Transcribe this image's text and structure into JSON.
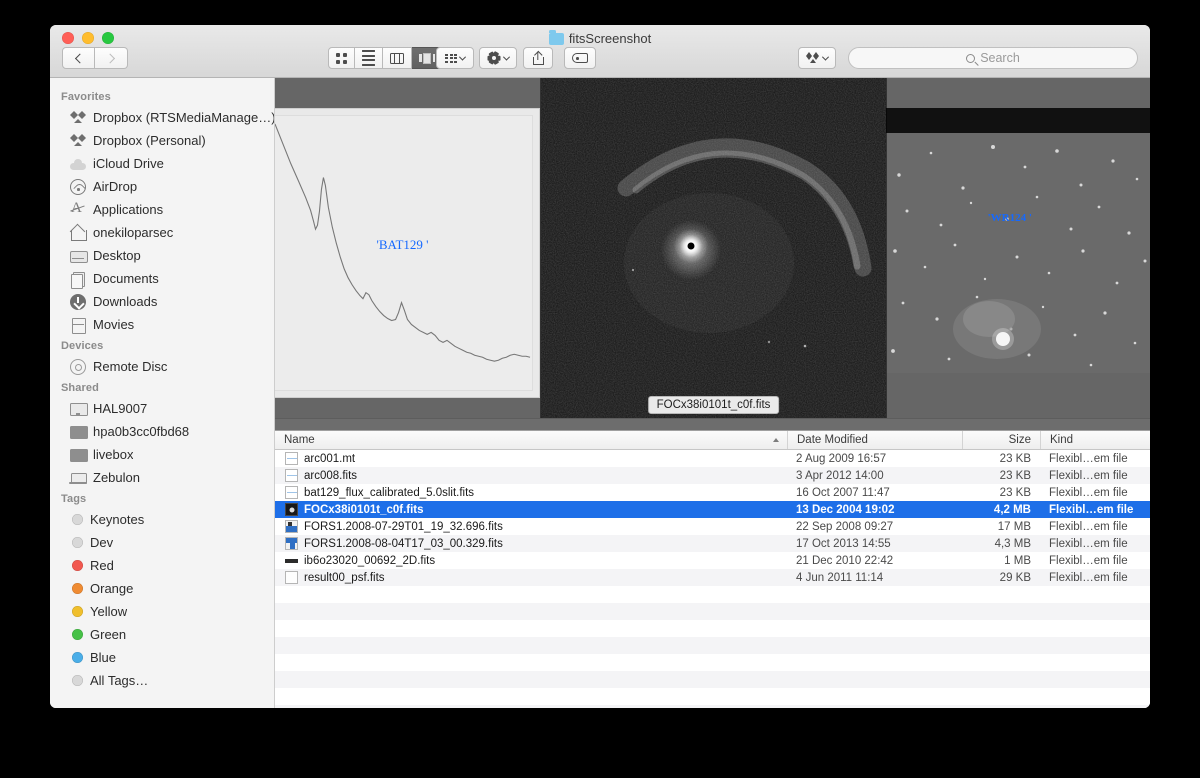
{
  "window": {
    "title": "fitsScreenshot",
    "title_icon": "blue-folder-icon",
    "traffic_lights": [
      "close",
      "minimize",
      "zoom"
    ]
  },
  "toolbar": {
    "back_label": "‹",
    "forward_label": "›",
    "view_modes": [
      {
        "name": "icon-view",
        "active": false
      },
      {
        "name": "list-view",
        "active": false
      },
      {
        "name": "column-view",
        "active": false
      },
      {
        "name": "coverflow-view",
        "active": true
      }
    ],
    "arrange_label": "arrange-icon",
    "action_label": "gear-icon",
    "share_label": "share-icon",
    "tag_label": "tag-icon",
    "dropbox_label": "dropbox-icon"
  },
  "search": {
    "placeholder": "Search",
    "value": ""
  },
  "sidebar": {
    "sections": [
      {
        "header": "Favorites",
        "items": [
          {
            "label": "Dropbox (RTSMediaManage…)",
            "icon": "dropbox-icon"
          },
          {
            "label": "Dropbox (Personal)",
            "icon": "dropbox-icon"
          },
          {
            "label": "iCloud Drive",
            "icon": "cloud-icon"
          },
          {
            "label": "AirDrop",
            "icon": "airdrop-icon"
          },
          {
            "label": "Applications",
            "icon": "applications-icon"
          },
          {
            "label": "onekiloparsec",
            "icon": "home-icon"
          },
          {
            "label": "Desktop",
            "icon": "desktop-icon"
          },
          {
            "label": "Documents",
            "icon": "documents-icon"
          },
          {
            "label": "Downloads",
            "icon": "downloads-icon"
          },
          {
            "label": "Movies",
            "icon": "movies-icon"
          }
        ]
      },
      {
        "header": "Devices",
        "items": [
          {
            "label": "Remote Disc",
            "icon": "disc-icon"
          }
        ]
      },
      {
        "header": "Shared",
        "items": [
          {
            "label": "HAL9007",
            "icon": "display-icon"
          },
          {
            "label": "hpa0b3cc0fbd68",
            "icon": "computer-icon"
          },
          {
            "label": "livebox",
            "icon": "computer-icon"
          },
          {
            "label": "Zebulon",
            "icon": "laptop-icon"
          }
        ]
      },
      {
        "header": "Tags",
        "items": [
          {
            "label": "Keynotes",
            "icon": "tag-dot",
            "color": "#d8d8d8"
          },
          {
            "label": "Dev",
            "icon": "tag-dot",
            "color": "#d8d8d8"
          },
          {
            "label": "Red",
            "icon": "tag-dot",
            "color": "#f1584f"
          },
          {
            "label": "Orange",
            "icon": "tag-dot",
            "color": "#ef8b32"
          },
          {
            "label": "Yellow",
            "icon": "tag-dot",
            "color": "#f0bf2c"
          },
          {
            "label": "Green",
            "icon": "tag-dot",
            "color": "#46c147"
          },
          {
            "label": "Blue",
            "icon": "tag-dot",
            "color": "#4aaee8"
          },
          {
            "label": "All Tags…",
            "icon": "tag-dot",
            "color": "#d8d8d8"
          }
        ]
      }
    ]
  },
  "coverflow": {
    "left_preview": {
      "label": "'BAT129  '",
      "type": "spectrum-plot"
    },
    "center_preview": {
      "caption": "FOCx38i0101t_c0f.fits",
      "type": "astronomical-image"
    },
    "right_preview": {
      "label": "'WR124  '",
      "type": "starfield-image"
    }
  },
  "file_list": {
    "columns": {
      "name": "Name",
      "date_modified": "Date Modified",
      "size": "Size",
      "kind": "Kind",
      "sort_column": "Name",
      "sort_direction": "ascending"
    },
    "rows": [
      {
        "name": "arc001.mt",
        "date": "2 Aug 2009 16:57",
        "size": "23 KB",
        "kind": "Flexibl…em file",
        "icon": "spectrum-thumb",
        "selected": false
      },
      {
        "name": "arc008.fits",
        "date": "3 Apr 2012 14:00",
        "size": "23 KB",
        "kind": "Flexibl…em file",
        "icon": "spectrum-thumb",
        "selected": false
      },
      {
        "name": "bat129_flux_calibrated_5.0slit.fits",
        "date": "16 Oct 2007 11:47",
        "size": "23 KB",
        "kind": "Flexibl…em file",
        "icon": "spectrum-thumb",
        "selected": false
      },
      {
        "name": "FOCx38i0101t_c0f.fits",
        "date": "13 Dec 2004 19:02",
        "size": "4,2 MB",
        "kind": "Flexibl…em file",
        "icon": "dark-image-thumb",
        "selected": true
      },
      {
        "name": "FORS1.2008-07-29T01_19_32.696.fits",
        "date": "22 Sep 2008 09:27",
        "size": "17 MB",
        "kind": "Flexibl…em file",
        "icon": "blue-image-thumb",
        "selected": false
      },
      {
        "name": "FORS1.2008-08-04T17_03_00.329.fits",
        "date": "17 Oct 2013 14:55",
        "size": "4,3 MB",
        "kind": "Flexibl…em file",
        "icon": "blue-image-thumb",
        "selected": false
      },
      {
        "name": "ib6o23020_00692_2D.fits",
        "date": "21 Dec 2010 22:42",
        "size": "1 MB",
        "kind": "Flexibl…em file",
        "icon": "bar-thumb",
        "selected": false
      },
      {
        "name": "result00_psf.fits",
        "date": "4 Jun 2011 11:14",
        "size": "29 KB",
        "kind": "Flexibl…em file",
        "icon": "blank-thumb",
        "selected": false
      }
    ]
  },
  "colors": {
    "selection_blue": "#1e6fe8",
    "label_blue": "#1569ff",
    "window_chrome": "#e6e6e6",
    "coverflow_bg": "#666666"
  }
}
